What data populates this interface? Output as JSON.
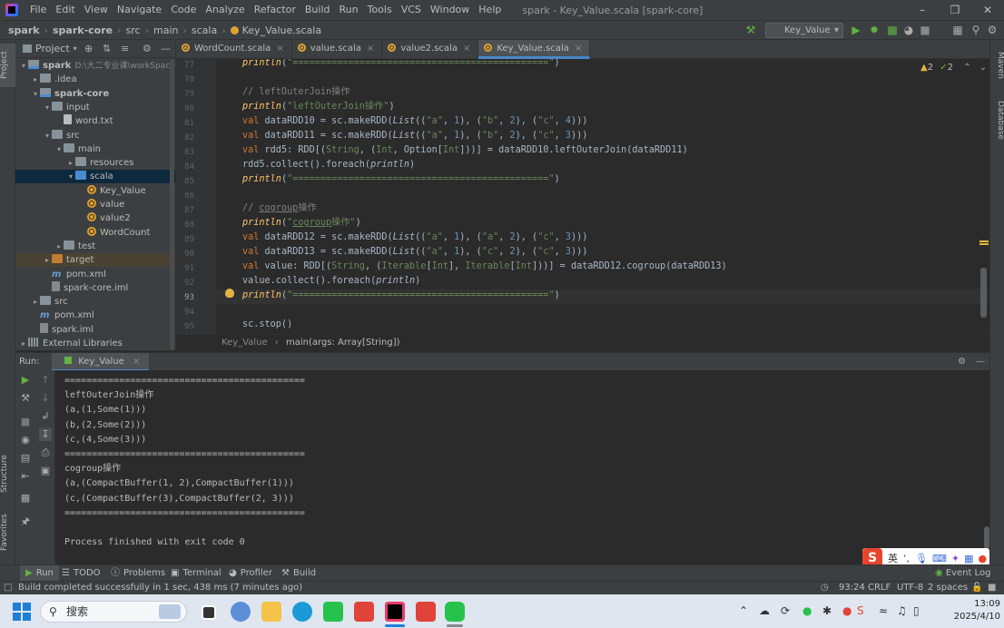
{
  "menubar": {
    "items": [
      "File",
      "Edit",
      "View",
      "Navigate",
      "Code",
      "Analyze",
      "Refactor",
      "Build",
      "Run",
      "Tools",
      "VCS",
      "Window",
      "Help"
    ],
    "window_title": "spark - Key_Value.scala [spark-core]"
  },
  "navbar": {
    "crumbs": [
      "spark",
      "spark-core",
      "src",
      "main",
      "scala",
      "Key_Value.scala"
    ],
    "run_config": "Key_Value"
  },
  "left_strip": {
    "project": "Project",
    "structure": "Structure",
    "favorites": "Favorites"
  },
  "right_strip": {
    "maven": "Maven",
    "database": "Database"
  },
  "project_panel": {
    "title": "Project",
    "tree": [
      {
        "label": "spark",
        "extra": "D:\\大二专业课\\workSpace",
        "depth": 0,
        "icon": "module",
        "open": true,
        "bold": true
      },
      {
        "label": ".idea",
        "depth": 1,
        "icon": "folder",
        "open": false
      },
      {
        "label": "spark-core",
        "depth": 1,
        "icon": "module",
        "open": true,
        "bold": true
      },
      {
        "label": "input",
        "depth": 2,
        "icon": "folder",
        "open": true
      },
      {
        "label": "word.txt",
        "depth": 3,
        "icon": "txt"
      },
      {
        "label": "src",
        "depth": 2,
        "icon": "folder",
        "open": true
      },
      {
        "label": "main",
        "depth": 3,
        "icon": "folder",
        "open": true
      },
      {
        "label": "resources",
        "depth": 4,
        "icon": "folder",
        "open": false
      },
      {
        "label": "scala",
        "depth": 4,
        "icon": "blue",
        "open": true,
        "selected": true
      },
      {
        "label": "Key_Value",
        "depth": 5,
        "icon": "scala"
      },
      {
        "label": "value",
        "depth": 5,
        "icon": "scala"
      },
      {
        "label": "value2",
        "depth": 5,
        "icon": "scala"
      },
      {
        "label": "WordCount",
        "depth": 5,
        "icon": "scala"
      },
      {
        "label": "test",
        "depth": 3,
        "icon": "folder",
        "open": false
      },
      {
        "label": "target",
        "depth": 2,
        "icon": "orange",
        "open": false,
        "highlight": true
      },
      {
        "label": "pom.xml",
        "depth": 2,
        "icon": "pom"
      },
      {
        "label": "spark-core.iml",
        "depth": 2,
        "icon": "iml"
      },
      {
        "label": "src",
        "depth": 1,
        "icon": "folder",
        "open": false
      },
      {
        "label": "pom.xml",
        "depth": 1,
        "icon": "pom"
      },
      {
        "label": "spark.iml",
        "depth": 1,
        "icon": "iml"
      },
      {
        "label": "External Libraries",
        "depth": 0,
        "icon": "libs",
        "open": false
      }
    ]
  },
  "editor_tabs": [
    {
      "label": "WordCount.scala",
      "active": false
    },
    {
      "label": "value.scala",
      "active": false
    },
    {
      "label": "value2.scala",
      "active": false
    },
    {
      "label": "Key_Value.scala",
      "active": true
    }
  ],
  "editor": {
    "inspections": {
      "warnings": "2",
      "ok": "2"
    },
    "current_line": "93",
    "line_numbers": [
      "77",
      "78",
      "79",
      "80",
      "81",
      "82",
      "83",
      "84",
      "85",
      "86",
      "87",
      "88",
      "89",
      "90",
      "91",
      "92",
      "93",
      "94",
      "95"
    ]
  },
  "editor_breadcrumb": {
    "object": "Key_Value",
    "method": "main(args: Array[String])"
  },
  "run": {
    "label": "Run:",
    "tab": "Key_Value",
    "output": [
      "============================================",
      "leftOuterJoin操作",
      "(a,(1,Some(1)))",
      "(b,(2,Some(2)))",
      "(c,(4,Some(3)))",
      "============================================",
      "cogroup操作",
      "(a,(CompactBuffer(1, 2),CompactBuffer(1)))",
      "(c,(CompactBuffer(3),CompactBuffer(2, 3)))",
      "============================================",
      "",
      "Process finished with exit code 0"
    ]
  },
  "ime": {
    "lang": "英"
  },
  "bottom_tabs": [
    "Run",
    "TODO",
    "Problems",
    "Terminal",
    "Profiler",
    "Build"
  ],
  "event_log": "Event Log",
  "status": {
    "message": "Build completed successfully in 1 sec, 438 ms (7 minutes ago)",
    "position": "93:24",
    "line_sep": "CRLF",
    "encoding": "UTF-8",
    "indent": "2 spaces"
  },
  "taskbar": {
    "search_placeholder": "搜索",
    "time": "13:09",
    "date": "2025/4/10"
  },
  "colors": {
    "accent": "#4a88c7",
    "selection": "#0d293e",
    "bg_editor": "#2b2b2b",
    "bg_panel": "#3c3f41"
  }
}
